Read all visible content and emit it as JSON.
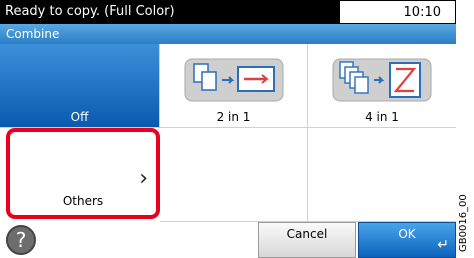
{
  "status": {
    "message": "Ready to copy. (Full Color)",
    "time": "10:10"
  },
  "title": "Combine",
  "options": {
    "off": {
      "label": "Off"
    },
    "two_in_one": {
      "label": "2 in 1"
    },
    "four_in_one": {
      "label": "4 in 1"
    },
    "others": {
      "label": "Others",
      "chevron": "›"
    }
  },
  "footer": {
    "help": "?",
    "cancel": "Cancel",
    "ok": "OK",
    "enter_icon": "↵"
  },
  "side_code": "GB0016_00",
  "colors": {
    "selected": "#0a5bb0",
    "highlight": "#e8001c",
    "ok": "#0c63bd"
  }
}
